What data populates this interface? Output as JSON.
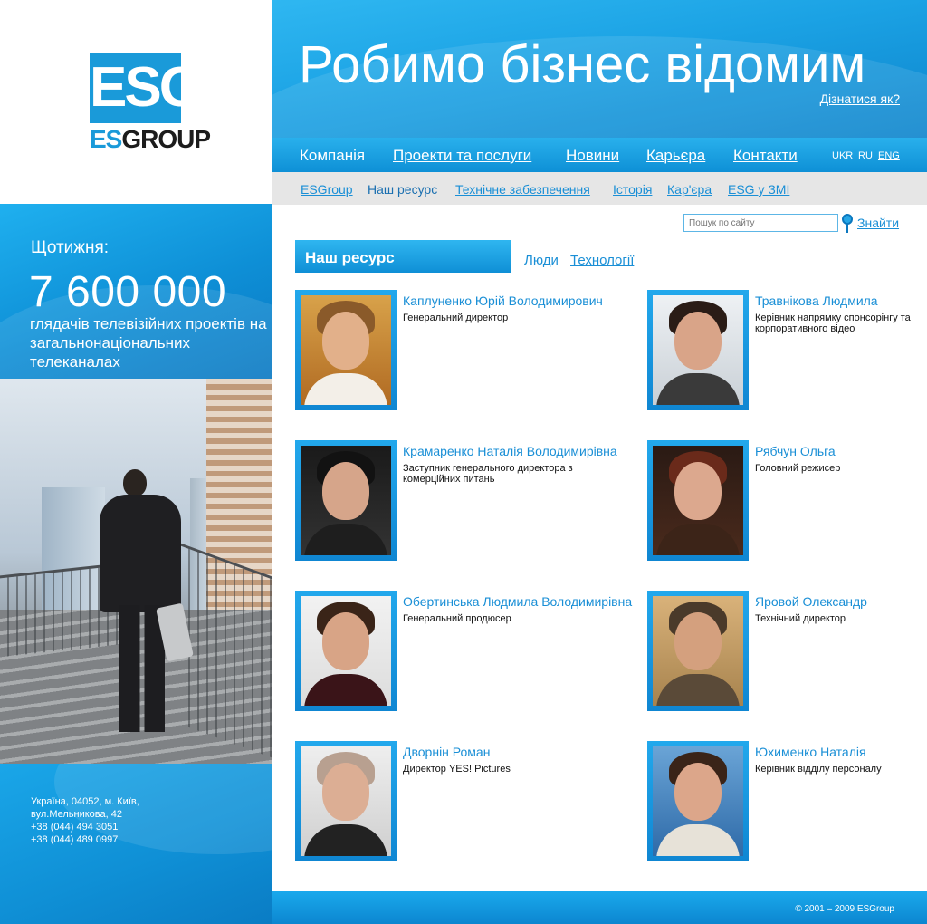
{
  "brand": {
    "logo_mark": "ESG",
    "logo_word_es": "ES",
    "logo_word_group": "GROUP",
    "accent": "#1a9ad9"
  },
  "stats": {
    "label": "Щотижня:",
    "number": "7 600 000",
    "description": "глядачів телевізійних проектів на загальнонаціональних телеканалах"
  },
  "address": {
    "line1": "Україна, 04052, м. Київ,",
    "line2": "вул.Мельникова, 42",
    "phone1": "+38 (044) 494 3051",
    "phone2": "+38 (044) 489 0997"
  },
  "header": {
    "slogan": "Робимо бізнес відомим",
    "learn_link": "Дізнатися як?"
  },
  "topnav": {
    "items": [
      "Компанія",
      "Проекти та послуги",
      "Новини",
      "Карьєра",
      "Контакти"
    ],
    "langs": [
      "UKR",
      "RU",
      "ENG"
    ]
  },
  "subnav": {
    "items": [
      "ESGroup",
      "Наш ресурс",
      "Технічне забезпечення",
      "Історія",
      "Кар'єра",
      "ESG у ЗМІ"
    ]
  },
  "search": {
    "placeholder": "Пошук по сайту",
    "button": "Знайти"
  },
  "tabs": {
    "active": "Наш ресурс",
    "items": [
      "Люди",
      "Технології"
    ]
  },
  "people": [
    {
      "name": "Каплуненко Юрій Володимирович",
      "role": "Генеральний директор"
    },
    {
      "name": "Травнікова Людмила",
      "role": "Керівник напрямку спонсорінгу та корпоративного відео"
    },
    {
      "name": "Крамаренко Наталія Володимирівна",
      "role": "Заступник генерального директора з комерційних питань"
    },
    {
      "name": "Рябчун Ольга",
      "role": "Головний режисер"
    },
    {
      "name": "Обертинська Людмила Володимирівна",
      "role": "Генеральний продюсер"
    },
    {
      "name": "Яровой Олександр",
      "role": "Технічний директор"
    },
    {
      "name": "Дворнін Роман",
      "role": "Директор YES! Pictures"
    },
    {
      "name": "Юхименко Наталія",
      "role": "Керівник відділу персоналу"
    }
  ],
  "footer": {
    "copyright": "©  2001 – 2009 ESGroup"
  }
}
